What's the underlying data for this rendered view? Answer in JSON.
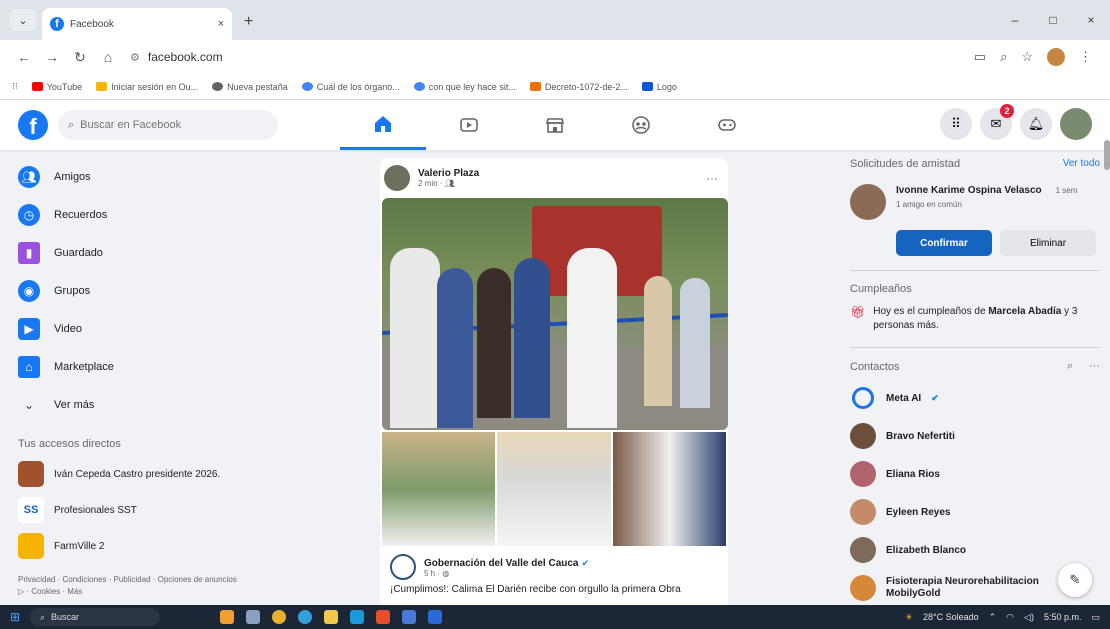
{
  "browser": {
    "tab_title": "Facebook",
    "tab_close": "×",
    "new_tab": "+",
    "tab_menu": "⌄",
    "url": "facebook.com",
    "window_controls": [
      "–",
      "□",
      "×"
    ]
  },
  "bookmarks": [
    {
      "label": "YouTube",
      "color": "#ff0000"
    },
    {
      "label": "Iniciar sesión en Ou...",
      "color": "#f4b400"
    },
    {
      "label": "Nueva pestaña",
      "color": "#5f6368"
    },
    {
      "label": "Cuál de los órgano...",
      "color": "#4285f4"
    },
    {
      "label": "con que ley hace sit...",
      "color": "#4285f4"
    },
    {
      "label": "Decreto-1072-de-2...",
      "color": "#e8710a"
    },
    {
      "label": "Logo",
      "color": "#0b57d0"
    }
  ],
  "fb": {
    "logo": "f",
    "search_placeholder": "Buscar en Facebook",
    "messenger_badge": "2",
    "accent": "#1877f2"
  },
  "left_nav": [
    {
      "label": "Amigos",
      "icon": "friends-icon",
      "color": "#1877f2"
    },
    {
      "label": "Recuerdos",
      "icon": "clock-icon",
      "color": "#1877f2"
    },
    {
      "label": "Guardado",
      "icon": "bookmark-icon",
      "color": "#9b51e0"
    },
    {
      "label": "Grupos",
      "icon": "groups-icon",
      "color": "#1877f2"
    },
    {
      "label": "Video",
      "icon": "video-icon",
      "color": "#1877f2"
    },
    {
      "label": "Marketplace",
      "icon": "store-icon",
      "color": "#1877f2"
    }
  ],
  "see_more": "Ver más",
  "shortcuts_title": "Tus accesos directos",
  "shortcuts": [
    {
      "label": "Iván Cepeda Castro presidente 2026.",
      "color": "#a0522d"
    },
    {
      "label": "Profesionales SST",
      "color": "#1565c0"
    },
    {
      "label": "FarmVille 2",
      "color": "#f4b400"
    }
  ],
  "footer": "Privacidad · Condiciones · Publicidad · Opciones de anuncios ▷ · Cookies · Más",
  "post": {
    "author": "Valerio Plaza",
    "time": "2 min · ",
    "more": "···",
    "shared_page": "Gobernación del Valle del Cauca",
    "shared_time": "5 h · ",
    "text": "¡Cumplimos!: Calima El Darién recibe con orgullo la primera Obra"
  },
  "friend_requests": {
    "title": "Solicitudes de amistad",
    "see_all": "Ver todo",
    "name": "Ivonne Karime Ospina Velasco",
    "time": "1 sem",
    "mutual": "1 amigo en común",
    "confirm": "Confirmar",
    "delete": "Eliminar"
  },
  "birthdays": {
    "title": "Cumpleaños",
    "text_prefix": "Hoy es el cumpleaños de ",
    "name": "Marcela Abadía",
    "text_suffix": " y 3 personas más."
  },
  "contacts": {
    "title": "Contactos",
    "items": [
      {
        "name": "Meta AI",
        "color": "#1a73e8"
      },
      {
        "name": "Bravo Nefertiti",
        "color": "#6b4f3a"
      },
      {
        "name": "Eliana Rios",
        "color": "#b0636b"
      },
      {
        "name": "Eyleen Reyes",
        "color": "#c48a6a"
      },
      {
        "name": "Elizabeth Blanco",
        "color": "#7d6a5a"
      },
      {
        "name": "Fisioterapia Neurorehabilitacion MobilyGold",
        "color": "#d4893a"
      }
    ]
  },
  "taskbar": {
    "search": "Buscar",
    "weather": "28°C  Soleado",
    "time": "5:50 p.m."
  }
}
